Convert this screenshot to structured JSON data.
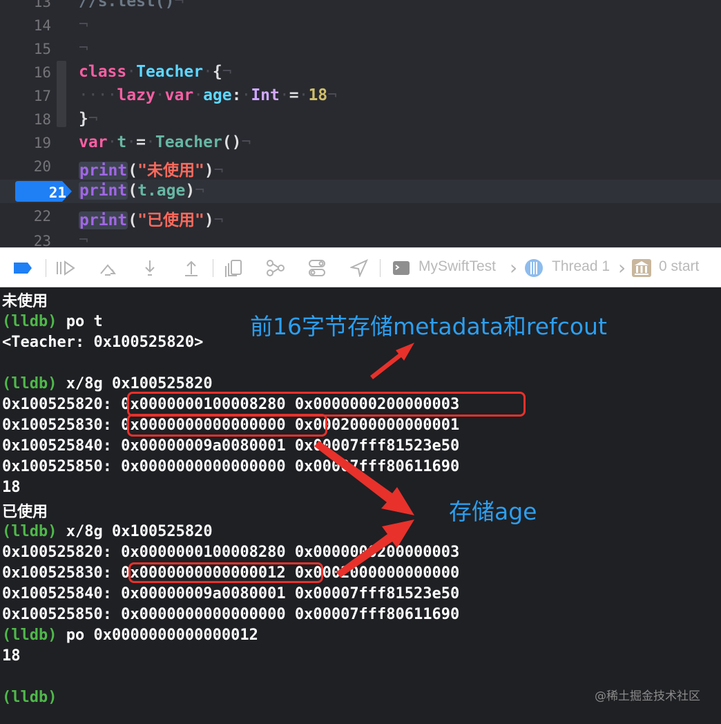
{
  "editor": {
    "lines": [
      {
        "n": "13",
        "text": "//s.test()"
      },
      {
        "n": "14"
      },
      {
        "n": "15"
      },
      {
        "n": "16"
      },
      {
        "n": "17"
      },
      {
        "n": "18"
      },
      {
        "n": "19"
      },
      {
        "n": "20"
      },
      {
        "n": "21"
      },
      {
        "n": "22"
      },
      {
        "n": "23"
      }
    ],
    "tokens": {
      "class_kw": "class",
      "teacher": "Teacher",
      "lazy": "lazy",
      "var": "var",
      "age": "age",
      "int": "Int",
      "eighteen": "18",
      "t": "t",
      "print": "print",
      "str_unused": "\"未使用\"",
      "str_used": "\"已使用\"",
      "t_age": "t.age",
      "pilcrow": "¬"
    },
    "current_line": "21"
  },
  "toolbar": {
    "scheme": "MySwiftTest",
    "thread": "Thread 1",
    "frame": "0 start"
  },
  "console": {
    "lines": [
      {
        "id": "l1",
        "text": "未使用"
      },
      {
        "id": "l2",
        "prompt": "(lldb)",
        "cmd": " po t"
      },
      {
        "id": "l3",
        "text": "<Teacher: 0x100525820>"
      },
      {
        "id": "l4",
        "prompt": "(lldb)",
        "cmd": " x/8g 0x100525820"
      },
      {
        "id": "l5",
        "text": "0x100525820: 0x0000000100008280 0x0000000200000003"
      },
      {
        "id": "l6",
        "text": "0x100525830: 0x0000000000000000 0x0002000000000001"
      },
      {
        "id": "l7",
        "text": "0x100525840: 0x00000009a0080001 0x00007fff81523e50"
      },
      {
        "id": "l8",
        "text": "0x100525850: 0x0000000000000000 0x00007fff80611690"
      },
      {
        "id": "l9",
        "text": "18"
      },
      {
        "id": "l10",
        "text": "已使用"
      },
      {
        "id": "l11",
        "prompt": "(lldb)",
        "cmd": " x/8g 0x100525820"
      },
      {
        "id": "l12",
        "text": "0x100525820: 0x0000000100008280 0x0000000200000003"
      },
      {
        "id": "l13",
        "text": "0x100525830: 0x0000000000000012 0x0002000000000000"
      },
      {
        "id": "l14",
        "text": "0x100525840: 0x00000009a0080001 0x00007fff81523e50"
      },
      {
        "id": "l15",
        "text": "0x100525850: 0x0000000000000000 0x00007fff80611690"
      },
      {
        "id": "l16",
        "prompt": "(lldb)",
        "cmd": " po 0x0000000000000012"
      },
      {
        "id": "l17",
        "text": "18"
      },
      {
        "id": "l18",
        "prompt": "(lldb)",
        "cmd": ""
      }
    ]
  },
  "annotations": {
    "metadata_note": "前16字节存储metadata和refcout",
    "age_note": "存储age",
    "watermark": "@稀土掘金技术社区"
  },
  "colors": {
    "editor_bg": "#292a30",
    "console_bg": "#1f2024",
    "keyword": "#fc5fa3",
    "type": "#5dd8ff",
    "prompt": "#4fb84a",
    "annotation_red": "#e8312b",
    "annotation_blue": "#2c9ff0",
    "breakpoint": "#1f7ff5"
  }
}
